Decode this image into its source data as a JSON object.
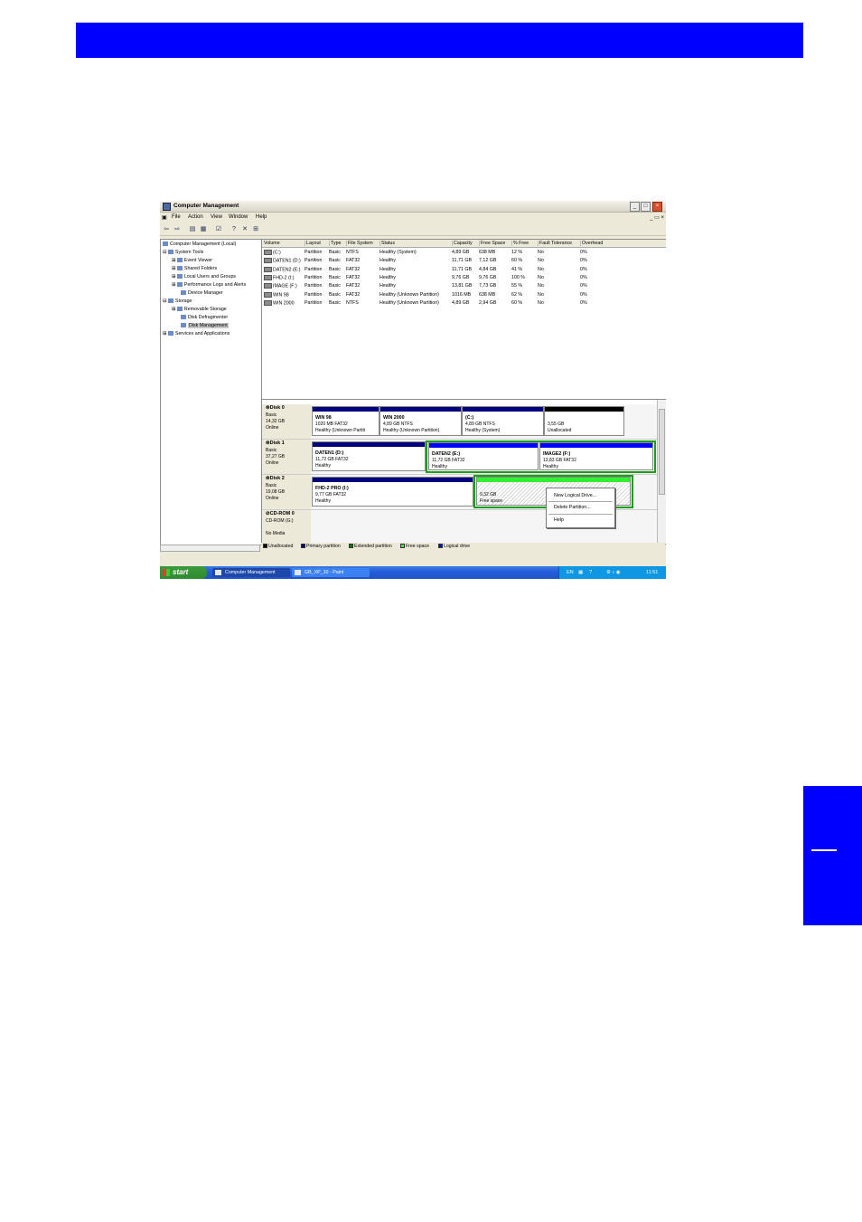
{
  "window": {
    "title": "Computer Management",
    "menu": [
      "File",
      "Action",
      "View",
      "Window",
      "Help"
    ]
  },
  "tree": {
    "items": [
      {
        "label": "Computer Management (Local)"
      },
      {
        "label": "System Tools"
      },
      {
        "label": "Event Viewer"
      },
      {
        "label": "Shared Folders"
      },
      {
        "label": "Local Users and Groups"
      },
      {
        "label": "Performance Logs and Alerts"
      },
      {
        "label": "Device Manager"
      },
      {
        "label": "Storage"
      },
      {
        "label": "Removable Storage"
      },
      {
        "label": "Disk Defragmenter"
      },
      {
        "label": "Disk Management"
      },
      {
        "label": "Services and Applications"
      }
    ]
  },
  "volumes": {
    "headers": [
      "Volume",
      "Layout",
      "Type",
      "File System",
      "Status",
      "Capacity",
      "Free Space",
      "% Free",
      "Fault Tolerance",
      "Overhead"
    ],
    "rows": [
      [
        "(C:)",
        "Partition",
        "Basic",
        "NTFS",
        "Healthy (System)",
        "4,89 GB",
        "638 MB",
        "12 %",
        "No",
        "0%"
      ],
      [
        "DATEN1 (D:)",
        "Partition",
        "Basic",
        "FAT32",
        "Healthy",
        "11,71 GB",
        "7,12 GB",
        "60 %",
        "No",
        "0%"
      ],
      [
        "DATEN2 (E:)",
        "Partition",
        "Basic",
        "FAT32",
        "Healthy",
        "11,71 GB",
        "4,84 GB",
        "41 %",
        "No",
        "0%"
      ],
      [
        "FHD-2 (I:)",
        "Partition",
        "Basic",
        "FAT32",
        "Healthy",
        "9,76 GB",
        "9,76 GB",
        "100 %",
        "No",
        "0%"
      ],
      [
        "IMAGE (F:)",
        "Partition",
        "Basic",
        "FAT32",
        "Healthy",
        "13,81 GB",
        "7,73 GB",
        "55 %",
        "No",
        "0%"
      ],
      [
        "WIN 98",
        "Partition",
        "Basic",
        "FAT32",
        "Healthy (Unknown Partition)",
        "1016 MB",
        "638 MB",
        "62 %",
        "No",
        "0%"
      ],
      [
        "WIN 2000",
        "Partition",
        "Basic",
        "NTFS",
        "Healthy (Unknown Partition)",
        "4,89 GB",
        "2,94 GB",
        "60 %",
        "No",
        "0%"
      ]
    ]
  },
  "disks": [
    {
      "name": "Disk 0",
      "type": "Basic",
      "size": "14,32 GB",
      "status": "Online",
      "partitions": [
        {
          "name": "WIN 98",
          "detail": "1020 MB FAT32",
          "status": "Healthy (Unknown Partiti"
        },
        {
          "name": "WIN 2000",
          "detail": "4,89 GB NTFS",
          "status": "Healthy (Unknown Partition)"
        },
        {
          "name": "(C:)",
          "detail": "4,89 GB NTFS",
          "status": "Healthy (System)"
        },
        {
          "name": "",
          "detail": "3,55 GB",
          "status": "Unallocated"
        }
      ]
    },
    {
      "name": "Disk 1",
      "type": "Basic",
      "size": "37,27 GB",
      "status": "Online",
      "partitions": [
        {
          "name": "DATEN1 (D:)",
          "detail": "11,72 GB FAT32",
          "status": "Healthy"
        },
        {
          "name": "DATEN2 (E:)",
          "detail": "11,72 GB FAT32",
          "status": "Healthy"
        },
        {
          "name": "IMAGE2 (F:)",
          "detail": "13,83 GB FAT32",
          "status": "Healthy"
        }
      ]
    },
    {
      "name": "Disk 2",
      "type": "Basic",
      "size": "19,08 GB",
      "status": "Online",
      "partitions": [
        {
          "name": "FHD-2 PRO (I:)",
          "detail": "9,77 GB FAT32",
          "status": "Healthy"
        },
        {
          "name": "",
          "detail": "9,32 GB",
          "status": "Free space"
        }
      ]
    },
    {
      "name": "CD-ROM 0",
      "type": "CD-ROM (G:)",
      "size": "",
      "status": "No Media",
      "partitions": []
    }
  ],
  "context_menu": [
    "New Logical Drive...",
    "Delete Partition...",
    "Help"
  ],
  "legend": [
    {
      "label": "Unallocated",
      "color": "#000000"
    },
    {
      "label": "Primary partition",
      "color": "#00007f"
    },
    {
      "label": "Extended partition",
      "color": "#0a7a0a"
    },
    {
      "label": "Free space",
      "color": "#33ee33"
    },
    {
      "label": "Logical drive",
      "color": "#0000ff"
    }
  ],
  "taskbar": {
    "start": "start",
    "tasks": [
      "Computer Management",
      "GB_XP_10 - Paint"
    ],
    "lang": "EN",
    "clock": "11:51"
  },
  "colors": {
    "accent": "#0000ff",
    "primary": "#00007f",
    "extended": "#1a9e1a",
    "free": "#33ee33"
  }
}
